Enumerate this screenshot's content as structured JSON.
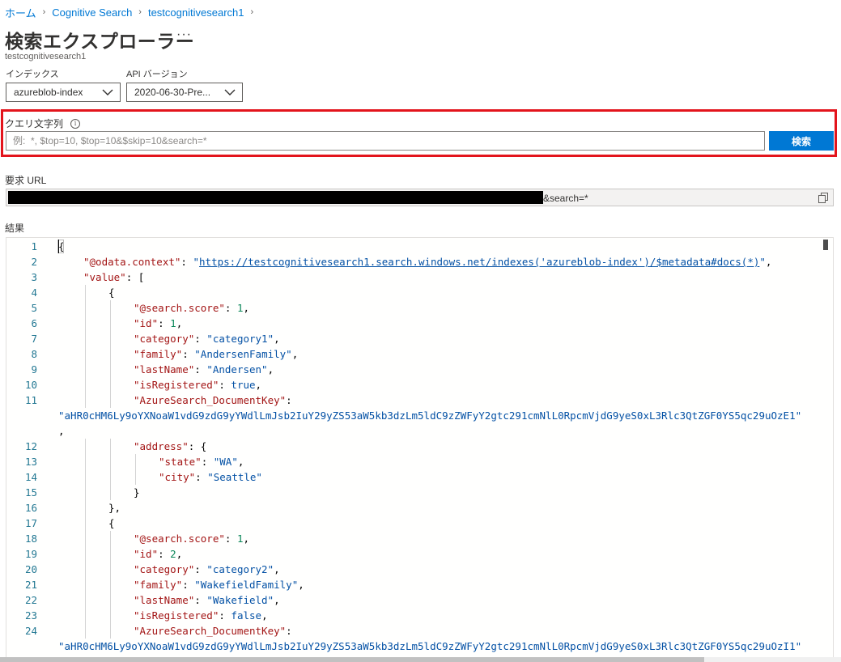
{
  "breadcrumb": [
    {
      "label": "ホーム"
    },
    {
      "label": "Cognitive Search"
    },
    {
      "label": "testcognitivesearch1"
    }
  ],
  "page": {
    "title": "検索エクスプローラー",
    "more_label": "···",
    "subtitle": "testcognitivesearch1"
  },
  "index_selector": {
    "label": "インデックス",
    "value": "azureblob-index"
  },
  "api_selector": {
    "label": "API バージョン",
    "value": "2020-06-30-Pre..."
  },
  "query": {
    "label": "クエリ文字列",
    "info_icon": "i",
    "placeholder": "例:  *, $top=10, $top=10&$skip=10&search=*",
    "value": "",
    "search_button": "検索"
  },
  "request_url": {
    "label": "要求 URL",
    "visible_suffix": "&search=*"
  },
  "results": {
    "label": "結果",
    "lines": [
      {
        "n": "1",
        "indent": 0,
        "tokens": [
          {
            "t": "{",
            "c": "p"
          }
        ]
      },
      {
        "n": "2",
        "indent": 1,
        "tokens": [
          {
            "t": "\"@odata.context\"",
            "c": "key"
          },
          {
            "t": ": ",
            "c": "p"
          },
          {
            "t": "\"",
            "c": "str"
          },
          {
            "t": "https://testcognitivesearch1.search.windows.net/indexes('azureblob-index')/$metadata#docs(*)",
            "c": "link"
          },
          {
            "t": "\"",
            "c": "str"
          },
          {
            "t": ",",
            "c": "p"
          }
        ]
      },
      {
        "n": "3",
        "indent": 1,
        "tokens": [
          {
            "t": "\"value\"",
            "c": "key"
          },
          {
            "t": ": [",
            "c": "p"
          }
        ]
      },
      {
        "n": "4",
        "indent": 2,
        "tokens": [
          {
            "t": "{",
            "c": "p"
          }
        ]
      },
      {
        "n": "5",
        "indent": 3,
        "tokens": [
          {
            "t": "\"@search.score\"",
            "c": "key"
          },
          {
            "t": ": ",
            "c": "p"
          },
          {
            "t": "1",
            "c": "num"
          },
          {
            "t": ",",
            "c": "p"
          }
        ]
      },
      {
        "n": "6",
        "indent": 3,
        "tokens": [
          {
            "t": "\"id\"",
            "c": "key"
          },
          {
            "t": ": ",
            "c": "p"
          },
          {
            "t": "1",
            "c": "num"
          },
          {
            "t": ",",
            "c": "p"
          }
        ]
      },
      {
        "n": "7",
        "indent": 3,
        "tokens": [
          {
            "t": "\"category\"",
            "c": "key"
          },
          {
            "t": ": ",
            "c": "p"
          },
          {
            "t": "\"category1\"",
            "c": "str"
          },
          {
            "t": ",",
            "c": "p"
          }
        ]
      },
      {
        "n": "8",
        "indent": 3,
        "tokens": [
          {
            "t": "\"family\"",
            "c": "key"
          },
          {
            "t": ": ",
            "c": "p"
          },
          {
            "t": "\"AndersenFamily\"",
            "c": "str"
          },
          {
            "t": ",",
            "c": "p"
          }
        ]
      },
      {
        "n": "9",
        "indent": 3,
        "tokens": [
          {
            "t": "\"lastName\"",
            "c": "key"
          },
          {
            "t": ": ",
            "c": "p"
          },
          {
            "t": "\"Andersen\"",
            "c": "str"
          },
          {
            "t": ",",
            "c": "p"
          }
        ]
      },
      {
        "n": "10",
        "indent": 3,
        "tokens": [
          {
            "t": "\"isRegistered\"",
            "c": "key"
          },
          {
            "t": ": ",
            "c": "p"
          },
          {
            "t": "true",
            "c": "kw"
          },
          {
            "t": ",",
            "c": "p"
          }
        ]
      },
      {
        "n": "11",
        "indent": 3,
        "tokens": [
          {
            "t": "\"AzureSearch_DocumentKey\"",
            "c": "key"
          },
          {
            "t": ":",
            "c": "p"
          }
        ]
      },
      {
        "n": "",
        "indent": 0,
        "tokens": [
          {
            "t": "\"aHR0cHM6Ly9oYXNoaW1vdG9zdG9yYWdlLmJsb2IuY29yZS53aW5kb3dzLm5ldC9zZWFyY2gtc291cmNlL0RpcmVjdG9yeS0xL3Rlc3QtZGF0YS5qc29uOzE1\"",
            "c": "str"
          }
        ]
      },
      {
        "n": "",
        "indent": 0,
        "tokens": [
          {
            "t": ",",
            "c": "p"
          }
        ]
      },
      {
        "n": "12",
        "indent": 3,
        "tokens": [
          {
            "t": "\"address\"",
            "c": "key"
          },
          {
            "t": ": {",
            "c": "p"
          }
        ]
      },
      {
        "n": "13",
        "indent": 4,
        "tokens": [
          {
            "t": "\"state\"",
            "c": "key"
          },
          {
            "t": ": ",
            "c": "p"
          },
          {
            "t": "\"WA\"",
            "c": "str"
          },
          {
            "t": ",",
            "c": "p"
          }
        ]
      },
      {
        "n": "14",
        "indent": 4,
        "tokens": [
          {
            "t": "\"city\"",
            "c": "key"
          },
          {
            "t": ": ",
            "c": "p"
          },
          {
            "t": "\"Seattle\"",
            "c": "str"
          }
        ]
      },
      {
        "n": "15",
        "indent": 3,
        "tokens": [
          {
            "t": "}",
            "c": "p"
          }
        ]
      },
      {
        "n": "16",
        "indent": 2,
        "tokens": [
          {
            "t": "},",
            "c": "p"
          }
        ]
      },
      {
        "n": "17",
        "indent": 2,
        "tokens": [
          {
            "t": "{",
            "c": "p"
          }
        ]
      },
      {
        "n": "18",
        "indent": 3,
        "tokens": [
          {
            "t": "\"@search.score\"",
            "c": "key"
          },
          {
            "t": ": ",
            "c": "p"
          },
          {
            "t": "1",
            "c": "num"
          },
          {
            "t": ",",
            "c": "p"
          }
        ]
      },
      {
        "n": "19",
        "indent": 3,
        "tokens": [
          {
            "t": "\"id\"",
            "c": "key"
          },
          {
            "t": ": ",
            "c": "p"
          },
          {
            "t": "2",
            "c": "num"
          },
          {
            "t": ",",
            "c": "p"
          }
        ]
      },
      {
        "n": "20",
        "indent": 3,
        "tokens": [
          {
            "t": "\"category\"",
            "c": "key"
          },
          {
            "t": ": ",
            "c": "p"
          },
          {
            "t": "\"category2\"",
            "c": "str"
          },
          {
            "t": ",",
            "c": "p"
          }
        ]
      },
      {
        "n": "21",
        "indent": 3,
        "tokens": [
          {
            "t": "\"family\"",
            "c": "key"
          },
          {
            "t": ": ",
            "c": "p"
          },
          {
            "t": "\"WakefieldFamily\"",
            "c": "str"
          },
          {
            "t": ",",
            "c": "p"
          }
        ]
      },
      {
        "n": "22",
        "indent": 3,
        "tokens": [
          {
            "t": "\"lastName\"",
            "c": "key"
          },
          {
            "t": ": ",
            "c": "p"
          },
          {
            "t": "\"Wakefield\"",
            "c": "str"
          },
          {
            "t": ",",
            "c": "p"
          }
        ]
      },
      {
        "n": "23",
        "indent": 3,
        "tokens": [
          {
            "t": "\"isRegistered\"",
            "c": "key"
          },
          {
            "t": ": ",
            "c": "p"
          },
          {
            "t": "false",
            "c": "kw"
          },
          {
            "t": ",",
            "c": "p"
          }
        ]
      },
      {
        "n": "24",
        "indent": 3,
        "tokens": [
          {
            "t": "\"AzureSearch_DocumentKey\"",
            "c": "key"
          },
          {
            "t": ":",
            "c": "p"
          }
        ]
      },
      {
        "n": "",
        "indent": 0,
        "tokens": [
          {
            "t": "\"aHR0cHM6Ly9oYXNoaW1vdG9zdG9yYWdlLmJsb2IuY29yZS53aW5kb3dzLm5ldC9zZWFyY2gtc291cmNlL0RpcmVjdG9yeS0xL3Rlc3QtZGF0YS5qc29uOzI1\"",
            "c": "str"
          }
        ]
      }
    ]
  },
  "colors": {
    "accent": "#0078d4",
    "highlight_border": "#e3141c",
    "json_key": "#a31515",
    "json_string": "#0451a5",
    "json_number": "#098658",
    "line_number": "#237893"
  }
}
